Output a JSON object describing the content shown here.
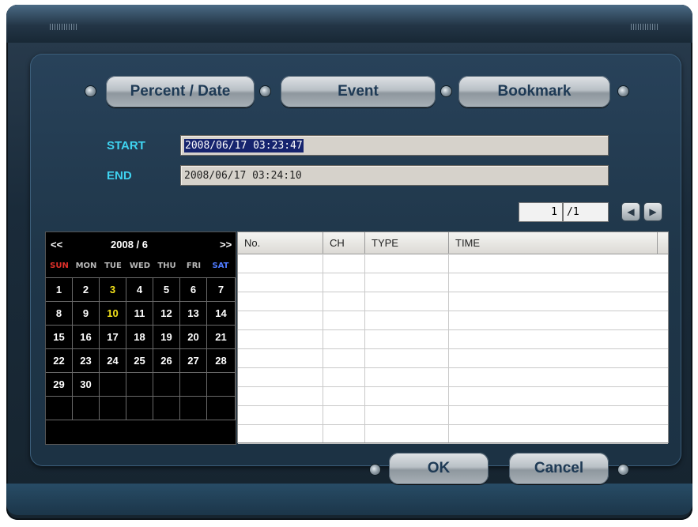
{
  "tabs": [
    {
      "label": "Percent / Date"
    },
    {
      "label": "Event"
    },
    {
      "label": "Bookmark"
    }
  ],
  "fields": {
    "start_label": "START",
    "start_value": "2008/06/17 03:23:47",
    "end_label": "END",
    "end_value": "2008/06/17 03:24:10"
  },
  "pager": {
    "current": "1",
    "total": "/1"
  },
  "calendar": {
    "prev": "<<",
    "title": "2008 / 6",
    "next": ">>",
    "weekdays": [
      "SUN",
      "MON",
      "TUE",
      "WED",
      "THU",
      "FRI",
      "SAT"
    ],
    "weekday_colors": {
      "SUN": "#e0302a",
      "SAT": "#4f7bff",
      "default": "#b9b9b9"
    },
    "weeks": [
      [
        "1",
        "2",
        "3",
        "4",
        "5",
        "6",
        "7"
      ],
      [
        "8",
        "9",
        "10",
        "11",
        "12",
        "13",
        "14"
      ],
      [
        "15",
        "16",
        "17",
        "18",
        "19",
        "20",
        "21"
      ],
      [
        "22",
        "23",
        "24",
        "25",
        "26",
        "27",
        "28"
      ],
      [
        "29",
        "30",
        "",
        "",
        "",
        "",
        ""
      ],
      [
        "",
        "",
        "",
        "",
        "",
        "",
        ""
      ]
    ],
    "highlight_dates": [
      "3",
      "10"
    ],
    "highlight_color": "#f4e21a"
  },
  "table": {
    "columns": [
      "No.",
      "CH",
      "TYPE",
      "TIME"
    ],
    "row_count": 10
  },
  "buttons": {
    "ok": "OK",
    "cancel": "Cancel"
  }
}
